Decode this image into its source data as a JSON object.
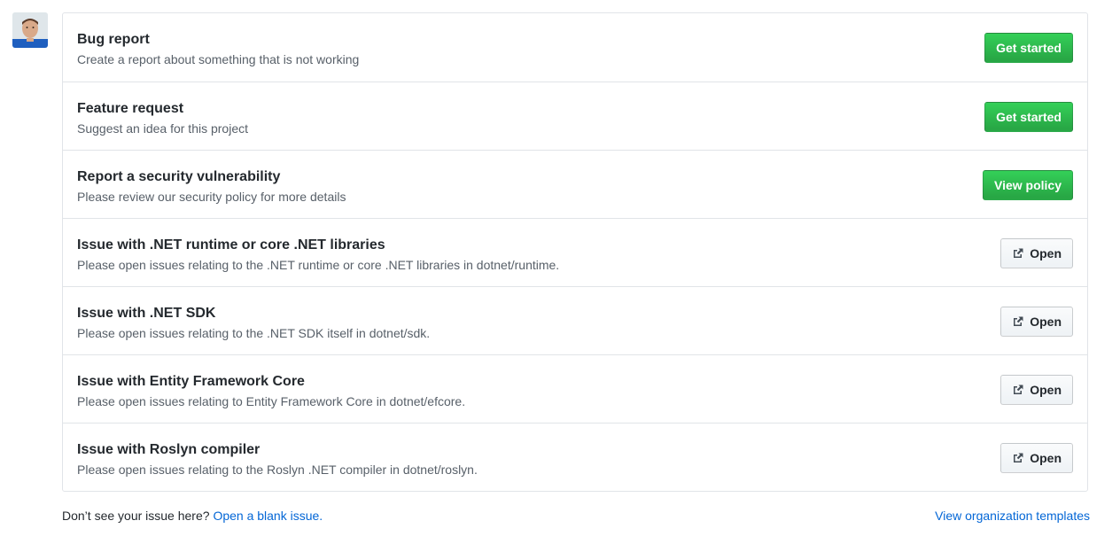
{
  "templates": [
    {
      "title": "Bug report",
      "description": "Create a report about something that is not working",
      "action": "Get started",
      "kind": "primary"
    },
    {
      "title": "Feature request",
      "description": "Suggest an idea for this project",
      "action": "Get started",
      "kind": "primary"
    },
    {
      "title": "Report a security vulnerability",
      "description": "Please review our security policy for more details",
      "action": "View policy",
      "kind": "primary"
    },
    {
      "title": "Issue with .NET runtime or core .NET libraries",
      "description": "Please open issues relating to the .NET runtime or core .NET libraries in dotnet/runtime.",
      "action": "Open",
      "kind": "external"
    },
    {
      "title": "Issue with .NET SDK",
      "description": "Please open issues relating to the .NET SDK itself in dotnet/sdk.",
      "action": "Open",
      "kind": "external"
    },
    {
      "title": "Issue with Entity Framework Core",
      "description": "Please open issues relating to Entity Framework Core in dotnet/efcore.",
      "action": "Open",
      "kind": "external"
    },
    {
      "title": "Issue with Roslyn compiler",
      "description": "Please open issues relating to the Roslyn .NET compiler in dotnet/roslyn.",
      "action": "Open",
      "kind": "external"
    }
  ],
  "footer": {
    "prompt": "Don’t see your issue here?",
    "blank_issue_link": "Open a blank issue.",
    "org_templates_link": "View organization templates"
  },
  "colors": {
    "primary_button": "#28a745",
    "link": "#0366d6",
    "border": "#e1e4e8",
    "muted_text": "#586069"
  }
}
